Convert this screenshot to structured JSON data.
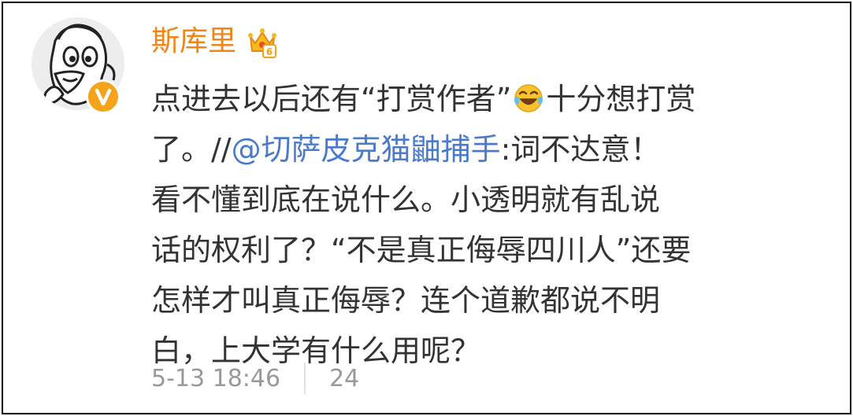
{
  "post": {
    "author": "斯库里",
    "level_badge": "6",
    "lines": {
      "l1a": "点进去以后还有“打赏作者”",
      "l1b": "十分想打赏",
      "l2a": "了。//",
      "l2mention": "@切萨皮克猫鼬捕手",
      "l2b": ":词不达意！",
      "l3": "看不懂到底在说什么。小透明就有乱说",
      "l4": "话的权利了？“不是真正侮辱四川人”还要",
      "l5": "怎样才叫真正侮辱？连个道歉都说不明",
      "l6": "白，上大学有什么用呢？"
    },
    "timestamp": "5-13 18:46",
    "like_count": "24"
  },
  "icons": {
    "avatar": "cartoon-avatar",
    "verified": "verified-v-icon",
    "crown": "crown-level-icon",
    "emoji": "laughing-crying-emoji-icon"
  },
  "colors": {
    "username": "#f08416",
    "mention": "#4b7ac9",
    "text": "#333333",
    "meta": "#999999",
    "badge": "#f5a41a"
  }
}
